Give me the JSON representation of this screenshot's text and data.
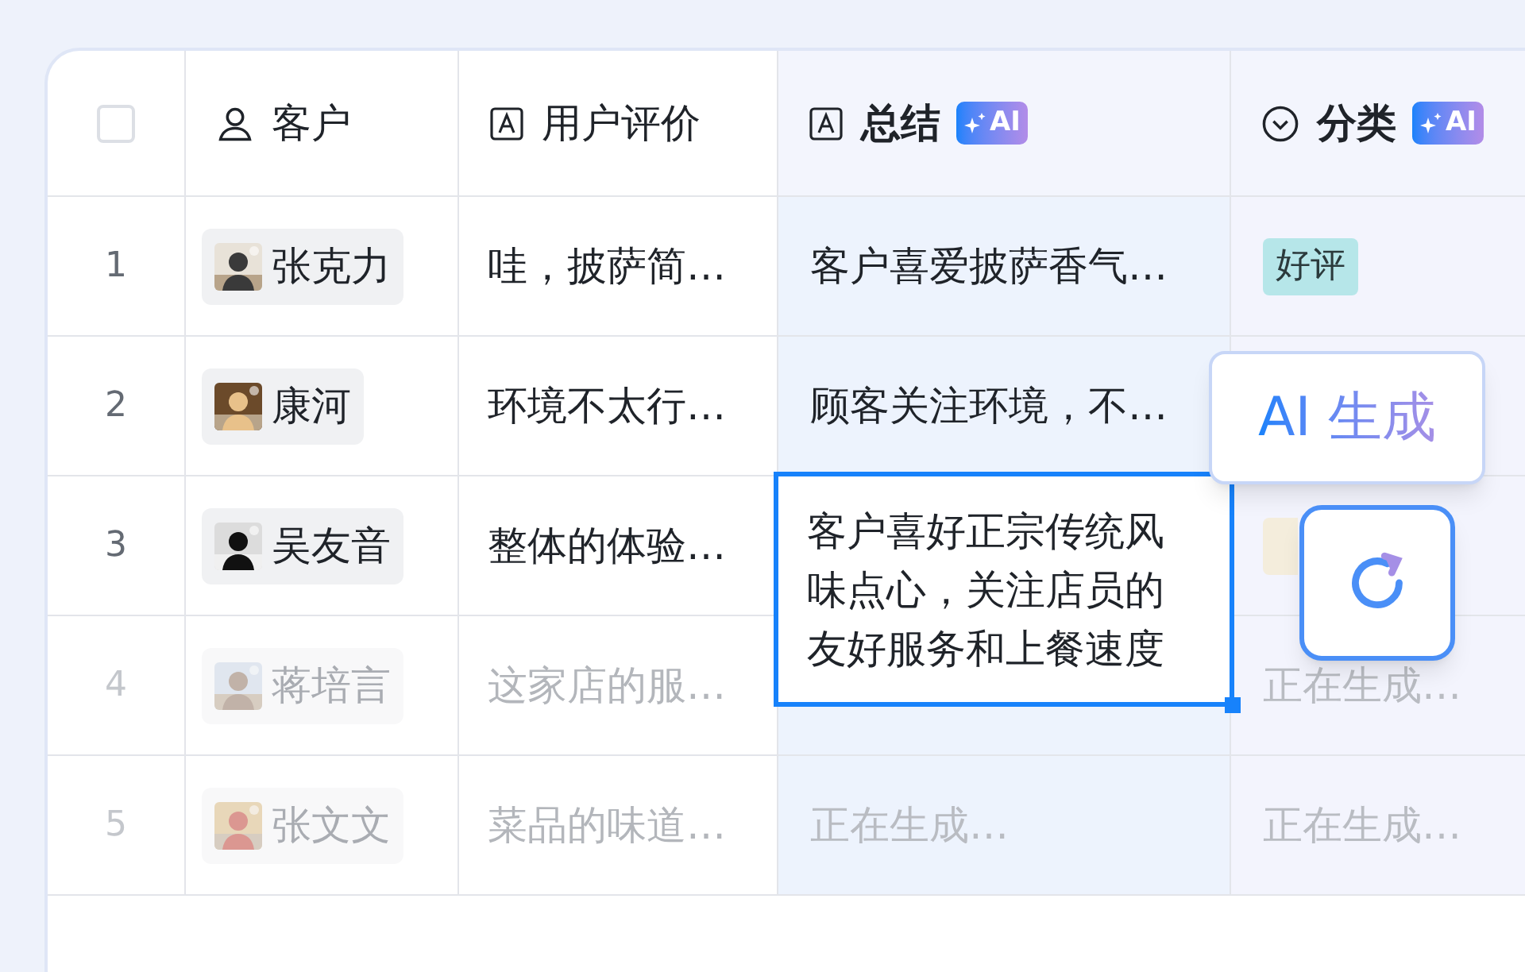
{
  "select_all": {
    "checked": false
  },
  "columns": [
    {
      "label": "客户",
      "kind": "person",
      "ai": false
    },
    {
      "label": "用户评价",
      "kind": "text",
      "ai": false
    },
    {
      "label": "总结",
      "kind": "text",
      "ai": true,
      "badge": "AI"
    },
    {
      "label": "分类",
      "kind": "select",
      "ai": true,
      "badge": "AI"
    }
  ],
  "rows": [
    {
      "number": "1",
      "kind": "done",
      "customer": "张克力",
      "review": "哇，披萨简…",
      "summary": "客户喜爱披萨香气…",
      "category": {
        "text": "好评",
        "color": "#b6e6e9"
      }
    },
    {
      "number": "2",
      "kind": "done",
      "customer": "康河",
      "review": "环境不太行…",
      "summary": "顾客关注环境，不…"
    },
    {
      "number": "3",
      "kind": "done",
      "customer": "吴友音",
      "review": "整体的体验…",
      "summary": "客户喜好正宗传统风味点心，关注店员的友好服务和上餐速度",
      "summary_selected": true,
      "category": {
        "color": "#f4eddc"
      }
    },
    {
      "number": "4",
      "kind": "generating",
      "customer": "蒋培言",
      "review": "这家店的服…",
      "category_text": "正在生成…"
    },
    {
      "number": "5",
      "kind": "generating",
      "customer": "张文文",
      "review": "菜品的味道…",
      "summary": "正在生成…",
      "category_text": "正在生成…"
    }
  ],
  "popup": {
    "label": "AI 生成"
  }
}
